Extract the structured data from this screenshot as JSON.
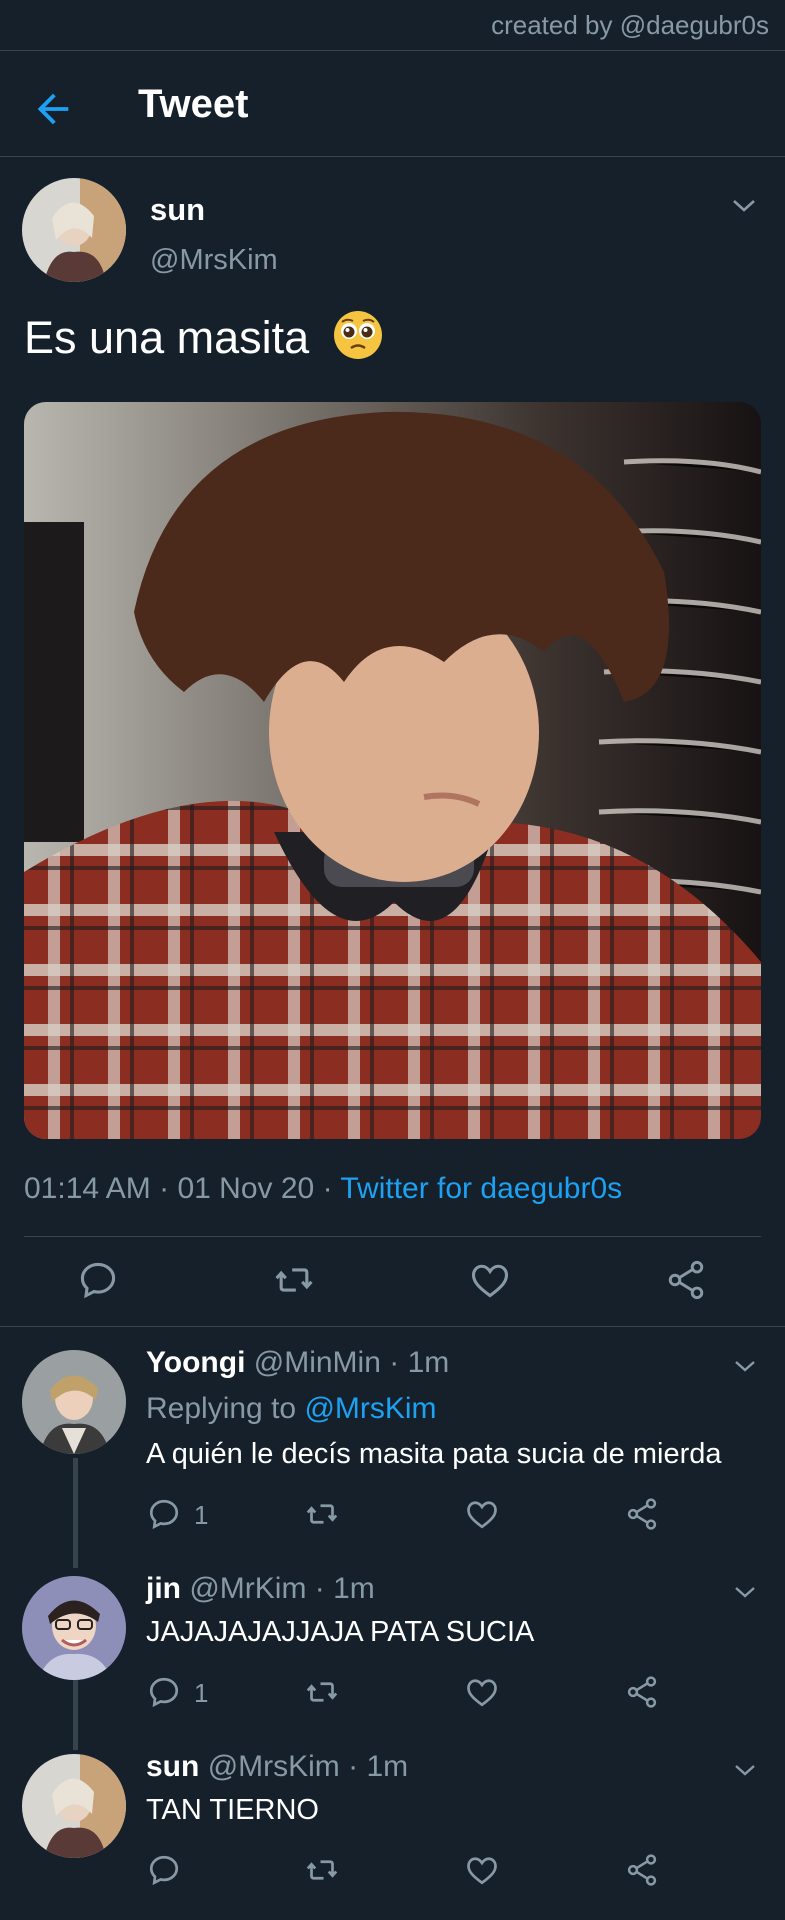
{
  "watermark": "created by @daegubr0s",
  "header": {
    "title": "Tweet",
    "back_icon": "arrow-left-icon"
  },
  "main_tweet": {
    "name": "sun",
    "handle": "@MrsKim",
    "text": "Es una masita",
    "emoji": "pleading-face-emoji",
    "time": "01:14 AM",
    "sep": "·",
    "date": "01 Nov 20",
    "source": "Twitter for daegubr0s",
    "image": "photo-of-person-in-red-plaid-shirt"
  },
  "actions": [
    "reply-icon",
    "retweet-icon",
    "like-icon",
    "share-icon"
  ],
  "replies": [
    {
      "name": "Yoongi",
      "handle": "@MinMin",
      "time": "· 1m",
      "replying_prefix": "Replying to",
      "replying_to": "@MrsKim",
      "text": "A quién le decís masita pata sucia de mierda",
      "reply_count": "1"
    },
    {
      "name": "jin",
      "handle": "@MrKim",
      "time": "· 1m",
      "text": "JAJAJAJAJJAJA PATA SUCIA",
      "reply_count": "1"
    },
    {
      "name": "sun",
      "handle": "@MrsKim",
      "time": "· 1m",
      "text": "TAN TIERNO",
      "reply_count": ""
    }
  ],
  "colors": {
    "background": "#15202b",
    "divider": "#38444d",
    "muted": "#8899a6",
    "accent": "#1da1f2"
  }
}
